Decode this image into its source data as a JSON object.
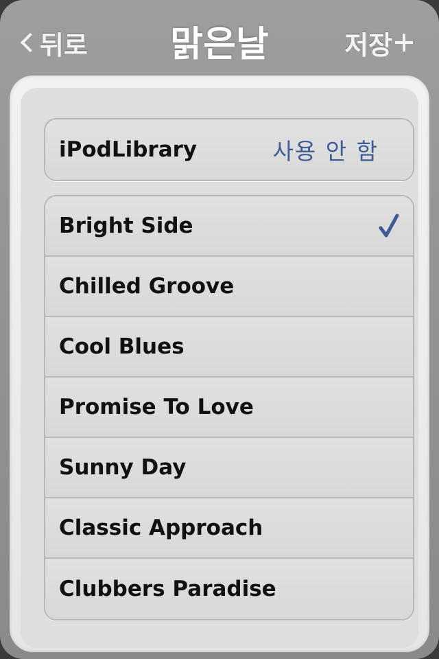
{
  "navbar": {
    "back_label": "뒤로",
    "title": "맑은날",
    "save_label": "저장"
  },
  "library": {
    "label": "iPodLibrary",
    "value": "사용 안 함"
  },
  "tracks": [
    {
      "name": "Bright Side",
      "selected": true
    },
    {
      "name": "Chilled Groove",
      "selected": false
    },
    {
      "name": "Cool Blues",
      "selected": false
    },
    {
      "name": "Promise To Love",
      "selected": false
    },
    {
      "name": "Sunny Day",
      "selected": false
    },
    {
      "name": "Classic Approach",
      "selected": false
    },
    {
      "name": "Clubbers Paradise",
      "selected": false
    }
  ],
  "colors": {
    "accent": "#3d5e94",
    "check": "#3d5e94"
  },
  "icons": {
    "back": "chevron-left-icon",
    "save": "plus-icon",
    "selected": "checkmark-icon"
  }
}
